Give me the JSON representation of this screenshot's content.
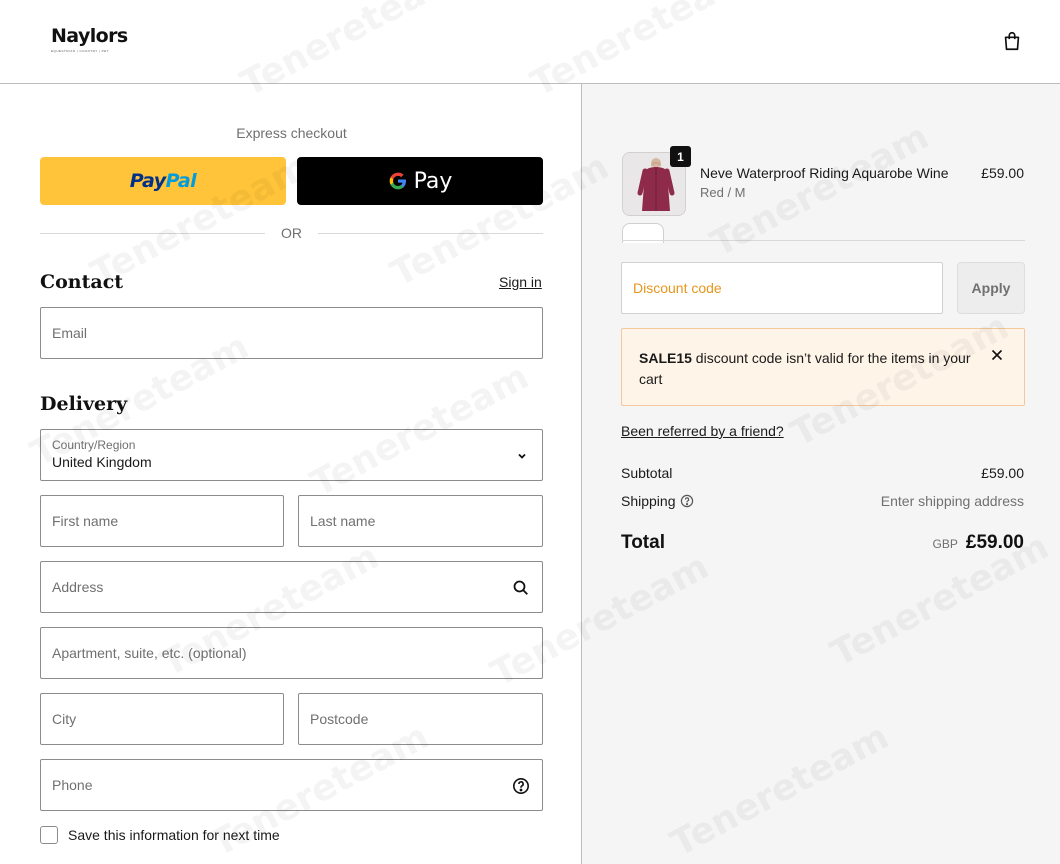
{
  "brand": {
    "logo_text": "Naylors",
    "logo_tagline": "EQUESTRIAN | COUNTRY | PET"
  },
  "express": {
    "title": "Express checkout",
    "paypal_part1": "Pay",
    "paypal_part2": "Pal",
    "gpay_label": "Pay",
    "or_label": "OR"
  },
  "contact": {
    "title": "Contact",
    "signin_label": "Sign in",
    "email_placeholder": "Email"
  },
  "delivery": {
    "title": "Delivery",
    "country_label": "Country/Region",
    "country_value": "United Kingdom",
    "first_name_placeholder": "First name",
    "last_name_placeholder": "Last name",
    "address_placeholder": "Address",
    "apartment_placeholder": "Apartment, suite, etc. (optional)",
    "city_placeholder": "City",
    "postcode_placeholder": "Postcode",
    "phone_placeholder": "Phone",
    "save_label": "Save this information for next time"
  },
  "cart": {
    "item": {
      "name": "Neve Waterproof Riding Aquarobe Wine",
      "variant": "Red / M",
      "price": "£59.00",
      "quantity": "1"
    },
    "discount_placeholder": "Discount code",
    "apply_label": "Apply",
    "alert_code": "SALE15",
    "alert_message": " discount code isn’t valid for the items in your cart",
    "referral_label": "Been referred by a friend?",
    "subtotal_label": "Subtotal",
    "subtotal_value": "£59.00",
    "shipping_label": "Shipping",
    "shipping_value": "Enter shipping address",
    "total_label": "Total",
    "total_currency": "GBP",
    "total_value": "£59.00"
  },
  "watermark": "Tenereteam",
  "colors": {
    "paypal_yellow": "#ffc439",
    "paypal_dark": "#003087",
    "paypal_light": "#009cde",
    "alert_bg": "#fff4e8",
    "alert_border": "#f4c89b",
    "discount_placeholder": "#e7961d",
    "product_wine": "#8e2a4a"
  }
}
